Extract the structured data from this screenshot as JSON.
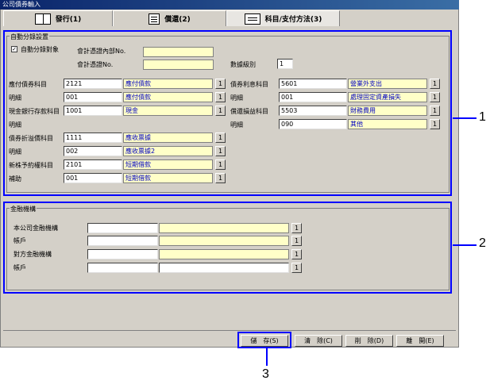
{
  "window": {
    "title": "公司債券輸入"
  },
  "tabs": [
    {
      "label": "發行(1)"
    },
    {
      "label": "償還(2)"
    },
    {
      "label": "科目/支付方法(3)"
    }
  ],
  "auto_section": {
    "legend": "自動分錄設置",
    "auto_checkbox_label": "自動分錄對象",
    "auto_checked": true,
    "voucher_dept_label": "會計憑證內部No.",
    "voucher_no_label": "會計憑證No.",
    "level_label": "數據級別",
    "level_value": "1",
    "left_rows": [
      {
        "label": "應付債券科目",
        "code": "2121",
        "name": "應付債款"
      },
      {
        "label": "明細",
        "code": "001",
        "name": "應付債款"
      },
      {
        "label": "現金銀行存款科目",
        "code": "1001",
        "name": "現金"
      },
      {
        "label": "明細",
        "code": "",
        "name": ""
      },
      {
        "label": "債券折溢價科目",
        "code": "1111",
        "name": "應收票據"
      },
      {
        "label": "明細",
        "code": "002",
        "name": "應收票據2"
      },
      {
        "label": "新株予約權科目",
        "code": "2101",
        "name": "短期借款"
      },
      {
        "label": "補助",
        "code": "001",
        "name": "短期借款"
      }
    ],
    "right_rows": [
      {
        "label": "債券利息科目",
        "code": "5601",
        "name": "營業外支出"
      },
      {
        "label": "明細",
        "code": "001",
        "name": "處理固定資產損失"
      },
      {
        "label": "償還損益科目",
        "code": "5503",
        "name": "財務費用"
      },
      {
        "label": "明細",
        "code": "090",
        "name": "其他"
      }
    ]
  },
  "bank_section": {
    "legend": "金融機構",
    "rows": [
      {
        "label": "本公司金融機構"
      },
      {
        "label": "帳戶"
      },
      {
        "label": "對方金融機構"
      },
      {
        "label": "帳戶"
      }
    ]
  },
  "pick_label": "1",
  "buttons": {
    "save": "儲　存(S)",
    "clear": "清　除(C)",
    "delete": "削　除(D)",
    "close": "離　開(E)"
  },
  "callouts": {
    "c1": "1",
    "c2": "2",
    "c3": "3"
  }
}
